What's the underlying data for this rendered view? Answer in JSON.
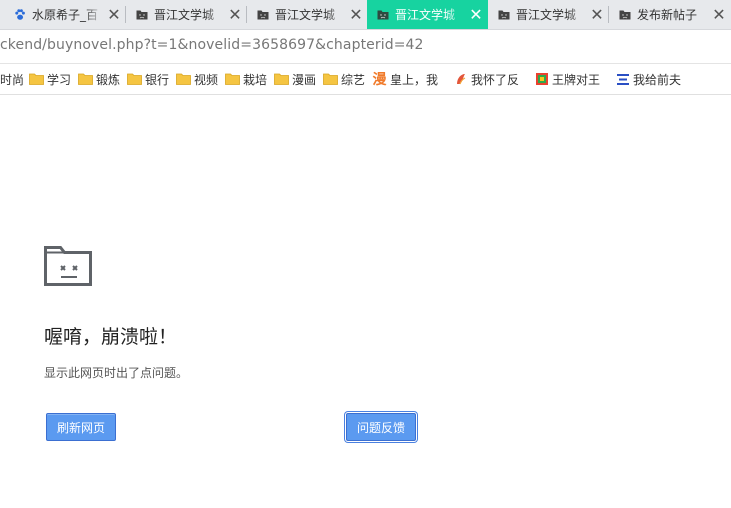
{
  "tabs": [
    {
      "label": "水原希子_百",
      "icon": "baidu-paw-icon",
      "active": false
    },
    {
      "label": "晋江文学城",
      "icon": "sad-folder-icon",
      "active": false
    },
    {
      "label": "晋江文学城",
      "icon": "sad-folder-icon",
      "active": false
    },
    {
      "label": "晋江文学城",
      "icon": "sad-folder-icon",
      "active": true
    },
    {
      "label": "晋江文学城",
      "icon": "sad-folder-icon",
      "active": false
    },
    {
      "label": "发布新帖子",
      "icon": "sad-folder-icon",
      "active": false
    }
  ],
  "close_glyph": "✕",
  "address": {
    "url": "ckend/buynovel.php?t=1&novelid=3658697&chapterid=42"
  },
  "bookmarks": [
    {
      "label": "时尚",
      "icon": "none"
    },
    {
      "label": "学习",
      "icon": "folder-icon"
    },
    {
      "label": "锻炼",
      "icon": "folder-icon"
    },
    {
      "label": "银行",
      "icon": "folder-icon"
    },
    {
      "label": "视频",
      "icon": "folder-icon"
    },
    {
      "label": "栽培",
      "icon": "folder-icon"
    },
    {
      "label": "漫画",
      "icon": "folder-icon"
    },
    {
      "label": "综艺",
      "icon": "folder-icon"
    },
    {
      "label": "皇上，我",
      "icon": "manhua-icon",
      "glyph": "漫"
    },
    {
      "label": "我怀了反",
      "icon": "site-favicon"
    },
    {
      "label": "王牌对王",
      "icon": "tv-favicon"
    },
    {
      "label": "我给前夫",
      "icon": "list-favicon"
    }
  ],
  "error": {
    "title": "喔唷，崩溃啦！",
    "description": "显示此网页时出了点问题。",
    "reload_label": "刷新网页",
    "feedback_label": "问题反馈"
  },
  "colors": {
    "active_tab": "#17d3a0",
    "button": "#5b9af0",
    "folder": "#f5c542"
  }
}
